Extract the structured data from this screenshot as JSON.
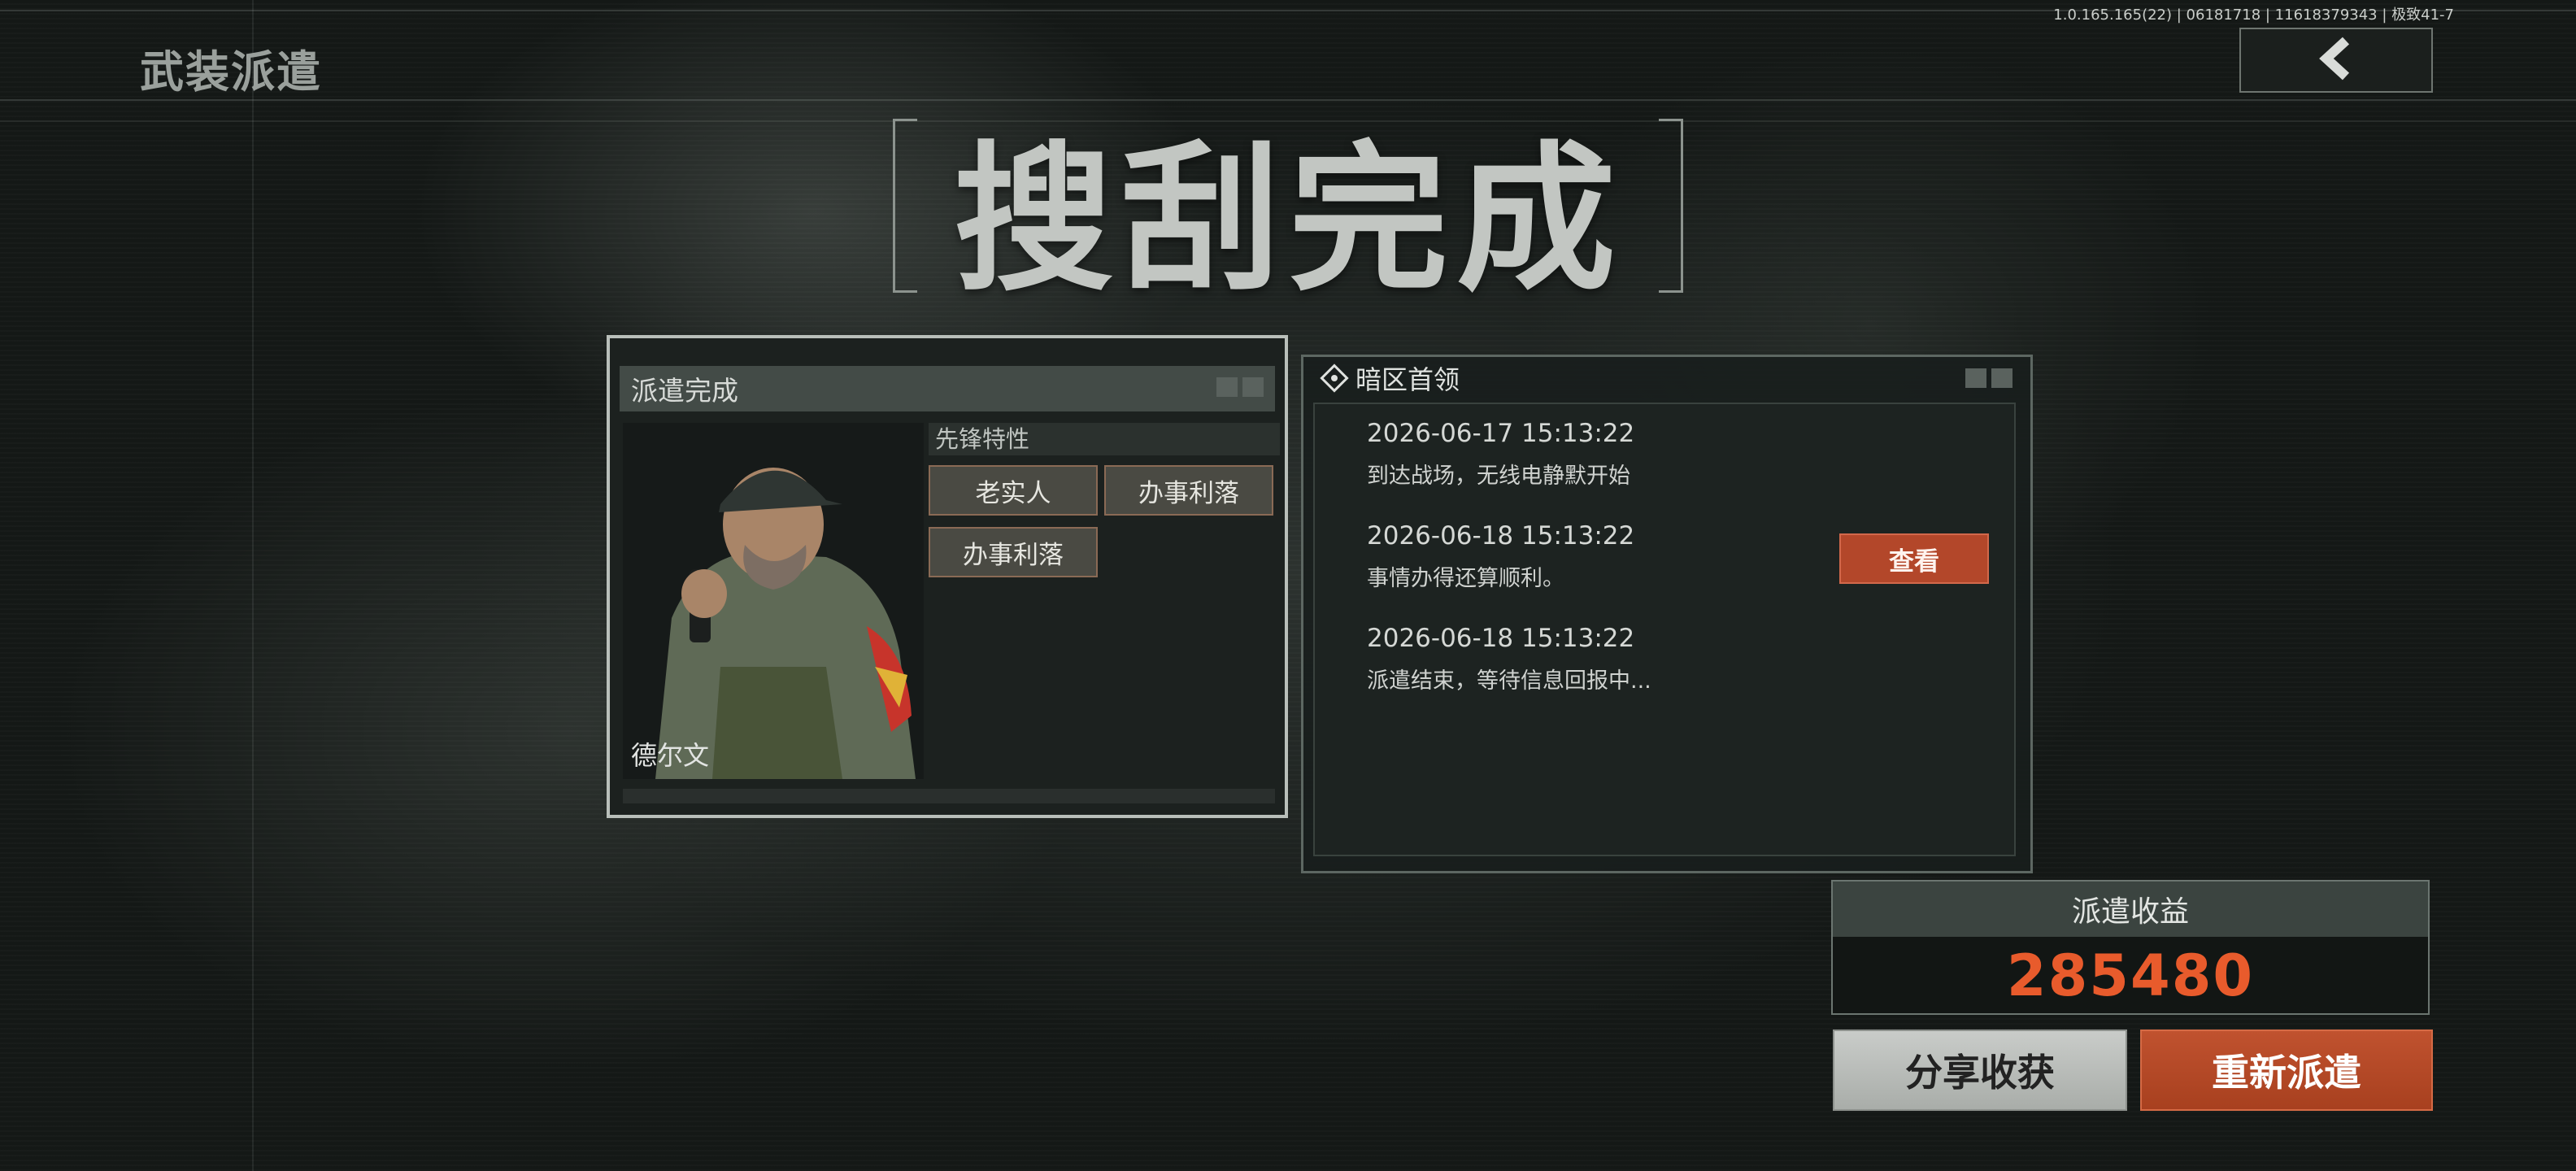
{
  "version_info": "1.0.165.165(22) | 06181718 | 11618379343 | 极致41-7",
  "mode_title": "武装派遣",
  "headline": "搜刮完成",
  "dispatch_card": {
    "title": "派遣完成",
    "character_name": "德尔文",
    "traits_title": "先锋特性",
    "traits": [
      "老实人",
      "办事利落",
      "办事利落"
    ]
  },
  "log_panel": {
    "title": "暗区首领",
    "entries": [
      {
        "time": "2026-06-17 15:13:22",
        "text": "到达战场，无线电静默开始"
      },
      {
        "time": "2026-06-18 15:13:22",
        "text": "事情办得还算顺利。"
      },
      {
        "time": "2026-06-18 15:13:22",
        "text": "派遣结束，等待信息回报中..."
      }
    ],
    "view_button": "查看"
  },
  "earnings": {
    "label": "派遣收益",
    "value": "285480"
  },
  "buttons": {
    "share": "分享收获",
    "redeploy": "重新派遣"
  },
  "icons": {
    "back": "chevron-left-icon",
    "panel": "diamond-target-icon"
  },
  "colors": {
    "accent_orange": "#e85b2c",
    "button_orange": "#b3472a"
  }
}
